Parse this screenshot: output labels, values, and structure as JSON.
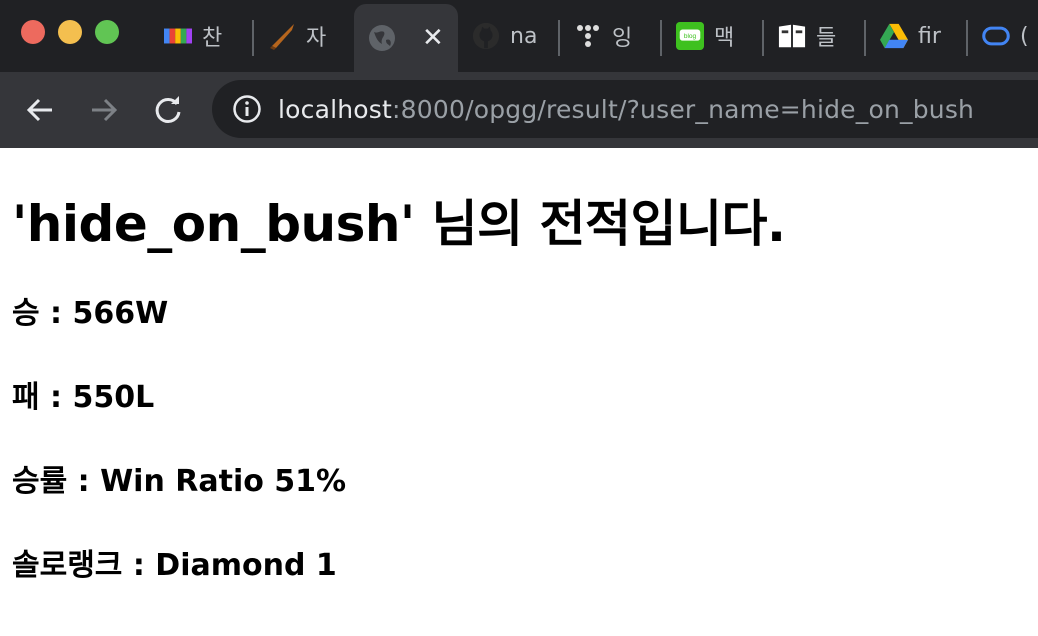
{
  "browser": {
    "tabs": [
      {
        "title": "찬",
        "favicon": "rainbow-bar-icon"
      },
      {
        "title": "자",
        "favicon": "sword-icon"
      },
      {
        "title": "",
        "favicon": "globe-icon",
        "active": true
      },
      {
        "title": "na",
        "favicon": "github-icon"
      },
      {
        "title": "잉",
        "favicon": "dots-logo-icon"
      },
      {
        "title": "맥",
        "favicon": "blog-icon"
      },
      {
        "title": "들",
        "favicon": "book-icon"
      },
      {
        "title": "fir",
        "favicon": "google-drive-icon"
      },
      {
        "title": "(",
        "favicon": "loop-icon"
      }
    ],
    "url_host": "localhost",
    "url_rest": ":8000/opgg/result/?user_name=hide_on_bush"
  },
  "page": {
    "heading": "'hide_on_bush' 님의 전적입니다.",
    "wins": "승 : 566W",
    "losses": "패 : 550L",
    "win_ratio": "승률 : Win Ratio 51%",
    "solo_rank": "솔로랭크 : Diamond 1"
  },
  "colors": {
    "titlebar": "#202124",
    "toolbar": "#35363a",
    "traffic_close": "#ed6a5e",
    "traffic_min": "#f4bf4f",
    "traffic_max": "#61c554"
  }
}
